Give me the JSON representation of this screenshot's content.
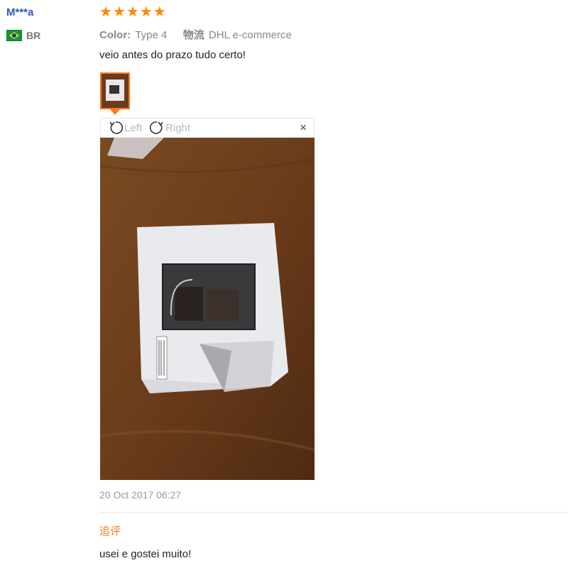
{
  "reviewer": {
    "name": "M***a",
    "country": "BR",
    "flag_icon": "brazil-flag-icon"
  },
  "rating": {
    "stars": 5,
    "max": 5,
    "color": "#ff8a00"
  },
  "meta": {
    "color_label": "Color:",
    "color_value": "Type 4",
    "shipping_label": "物流",
    "shipping_value": "DHL e-commerce"
  },
  "review_text": "veio antes do prazo tudo certo!",
  "viewer": {
    "rotate_left_label": "Left",
    "rotate_right_label": "Right",
    "close_label": "×"
  },
  "timestamp": "20 Oct 2017 06:27",
  "followup": {
    "title": "追评",
    "text": "usei e gostei muito!"
  },
  "colors": {
    "accent": "#ff7a1a",
    "username": "#2b57b5"
  }
}
